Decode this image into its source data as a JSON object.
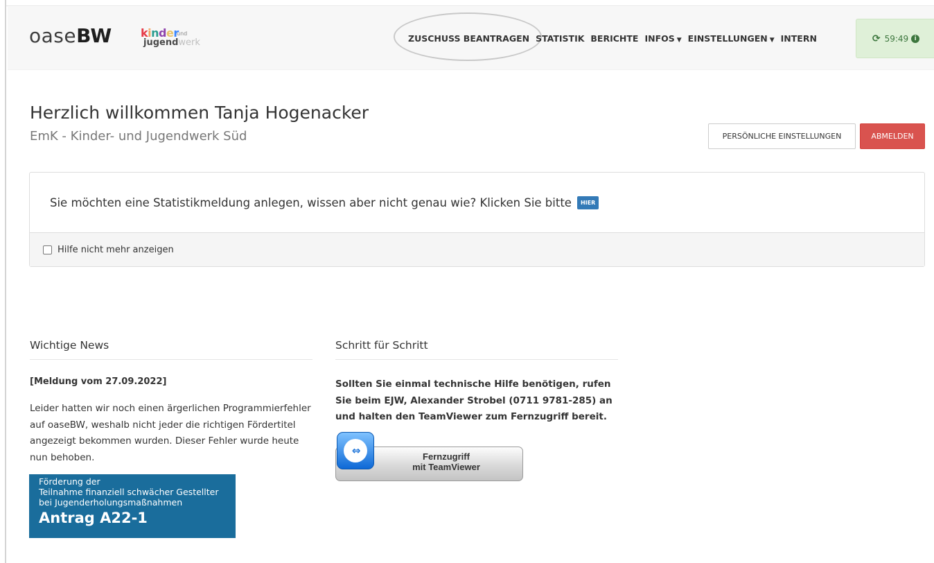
{
  "brand": {
    "prefix": "oase",
    "suffix": "BW"
  },
  "partner_logo": {
    "kinder": [
      "k",
      "i",
      "n",
      "d",
      "e",
      "r"
    ],
    "und": "und",
    "jugend": "jugend",
    "werk": "werk"
  },
  "nav": {
    "items": [
      {
        "label": "ZUSCHUSS BEANTRAGEN",
        "dropdown": false
      },
      {
        "label": "STATISTIK",
        "dropdown": false
      },
      {
        "label": "BERICHTE",
        "dropdown": false
      },
      {
        "label": "INFOS",
        "dropdown": true
      },
      {
        "label": "EINSTELLUNGEN",
        "dropdown": true
      },
      {
        "label": "INTERN",
        "dropdown": false
      }
    ]
  },
  "session": {
    "timer": "59:49",
    "icon": "refresh-icon",
    "info_icon": "info-icon"
  },
  "header": {
    "title": "Herzlich willkommen Tanja Hogenacker",
    "subtitle": "EmK - Kinder- und Jugendwerk Süd",
    "settings_button": "PERSÖNLICHE EINSTELLUNGEN",
    "logout_button": "ABMELDEN"
  },
  "help": {
    "text": "Sie möchten eine Statistikmeldung anlegen, wissen aber nicht genau wie? Klicken Sie bitte",
    "link_label": "HIER",
    "checkbox_label": "Hilfe nicht mehr anzeigen",
    "checkbox_checked": false
  },
  "news": {
    "title": "Wichtige News",
    "date": "[Meldung vom 27.09.2022]",
    "text": "Leider hatten wir noch einen ärgerlichen Programmierfehler auf oaseBW, weshalb nicht jeder die richtigen Fördertitel angezeigt bekommen wurden. Dieser Fehler wurde heute nun behoben.",
    "banner": {
      "lines": [
        "Förderung der",
        "Teilnahme finanziell schwächer Gestellter",
        "bei Jugenderholungsmaßnahmen"
      ],
      "headline": "Antrag A22-1"
    }
  },
  "steps": {
    "title": "Schritt für Schritt",
    "text": "Sollten Sie einmal technische Hilfe benötigen, rufen Sie beim EJW, Alexander Strobel (0711 9781-285) an und halten den TeamViewer zum Fernzugriff bereit.",
    "teamviewer": {
      "line1": "Fernzugriff",
      "line2": "mit TeamViewer"
    }
  },
  "colors": {
    "danger": "#d9534f",
    "primary": "#337ab7",
    "success_bg": "#dff0d8",
    "banner": "#1a6d9c"
  }
}
